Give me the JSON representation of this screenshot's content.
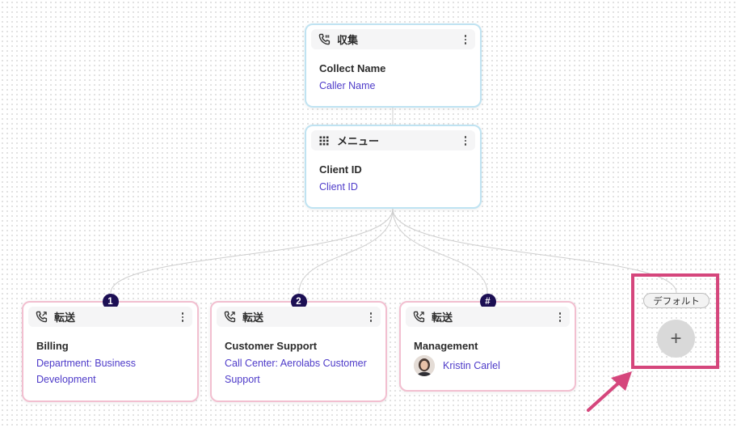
{
  "nodes": {
    "collect": {
      "title": "収集",
      "label": "Collect Name",
      "value": "Caller Name"
    },
    "menu": {
      "title": "メニュー",
      "label": "Client ID",
      "value": "Client ID"
    },
    "billing": {
      "badge": "1",
      "title": "転送",
      "label": "Billing",
      "value": "Department: Business Development"
    },
    "support": {
      "badge": "2",
      "title": "転送",
      "label": "Customer Support",
      "value": "Call Center: Aerolabs Customer Support"
    },
    "management": {
      "badge": "#",
      "title": "転送",
      "label": "Management",
      "agent_name": "Kristin Carlel"
    }
  },
  "default_branch": {
    "label": "デフォルト",
    "add_symbol": "+"
  },
  "colors": {
    "collect_border": "#bfe3f2",
    "transfer_border": "#f2bfd0",
    "badge_bg": "#1c0f54",
    "link_text": "#4e3bc9",
    "highlight": "#d5467c"
  },
  "icons": {
    "collect": "phone-icon",
    "menu": "keypad-grid-icon",
    "transfer": "phone-forward-icon",
    "more": "kebab-menu-icon",
    "add": "plus-icon"
  }
}
